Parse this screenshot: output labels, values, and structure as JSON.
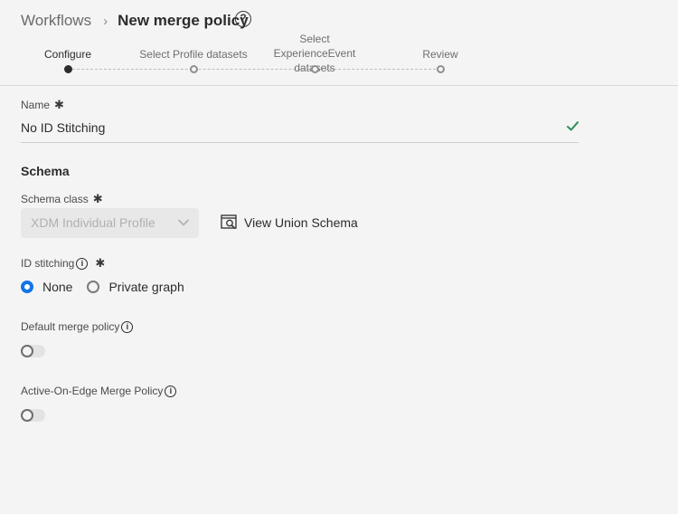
{
  "header": {
    "breadcrumb_root": "Workflows",
    "breadcrumb_separator": "›",
    "page_title": "New merge policy",
    "help_icon": "?"
  },
  "stepper": {
    "steps": [
      {
        "label": "Configure",
        "state": "active"
      },
      {
        "label": "Select Profile datasets",
        "state": "pending"
      },
      {
        "label": "Select ExperienceEvent datasets",
        "state": "pending"
      },
      {
        "label": "Review",
        "state": "pending"
      }
    ]
  },
  "form": {
    "name": {
      "label": "Name",
      "required_mark": "✱",
      "value": "No ID Stitching",
      "valid": true
    },
    "schema_section_title": "Schema",
    "schema_class": {
      "label": "Schema class",
      "required_mark": "✱",
      "value": "XDM Individual Profile",
      "disabled": true
    },
    "view_union_schema_label": "View Union Schema",
    "id_stitching": {
      "label": "ID stitching",
      "info_icon": "i",
      "required_mark": "✱",
      "options": [
        {
          "label": "None",
          "selected": true
        },
        {
          "label": "Private graph",
          "selected": false
        }
      ]
    },
    "default_merge_policy": {
      "label": "Default merge policy",
      "info_icon": "i",
      "on": false
    },
    "active_on_edge": {
      "label": "Active-On-Edge Merge Policy",
      "info_icon": "i",
      "on": false
    }
  },
  "colors": {
    "accent": "#1473e6",
    "valid": "#2d8f5c",
    "background": "#f4f4f4"
  }
}
